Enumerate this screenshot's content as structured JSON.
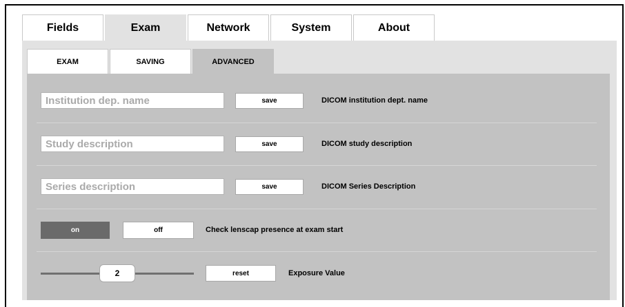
{
  "main_tabs": [
    {
      "label": "Fields",
      "active": false
    },
    {
      "label": "Exam",
      "active": true
    },
    {
      "label": "Network",
      "active": false
    },
    {
      "label": "System",
      "active": false
    },
    {
      "label": "About",
      "active": false
    }
  ],
  "sub_tabs": [
    {
      "label": "EXAM",
      "active": false
    },
    {
      "label": "SAVING",
      "active": false
    },
    {
      "label": "ADVANCED",
      "active": true
    }
  ],
  "fields": [
    {
      "placeholder": "Institution dep. name",
      "button": "save",
      "description": "DICOM institution dept. name"
    },
    {
      "placeholder": "Study description",
      "button": "save",
      "description": "DICOM study description"
    },
    {
      "placeholder": "Series description",
      "button": "save",
      "description": "DICOM Series Description"
    }
  ],
  "lenscap": {
    "on_label": "on",
    "off_label": "off",
    "selected": "on",
    "description": "Check lenscap presence at exam start"
  },
  "exposure": {
    "value": "2",
    "reset_label": "reset",
    "description": "Exposure Value"
  },
  "colors": {
    "tab_active": "#e2e2e2",
    "panel": "#c2c2c2",
    "toggle_on": "#6a6a6a"
  }
}
